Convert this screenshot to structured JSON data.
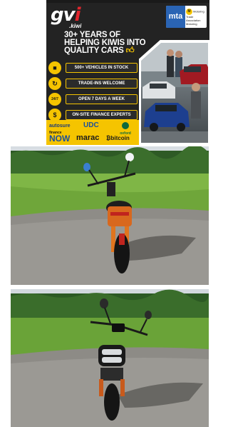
{
  "ad": {
    "logo_main_prefix": "gv",
    "logo_main_accent": "i",
    "logo_sub": ".kiwi",
    "mta_left": "mta",
    "mta_badge": "M",
    "mta_lines": [
      "Motoring",
      "Trade",
      "Association",
      "Motoring"
    ],
    "headline_line1": "30+ YEARS OF",
    "headline_line2": "HELPING KIWIS INTO",
    "headline_line3": "QUALITY CARS",
    "thumb_icon": "thumbs-up-icon",
    "features": [
      {
        "icon": "car-icon",
        "label": "500+ VEHICLES IN STOCK"
      },
      {
        "icon": "refresh-icon",
        "label": "TRADE-INS WELCOME"
      },
      {
        "icon": "clock-icon",
        "label": "OPEN 7 DAYS A WEEK"
      },
      {
        "icon": "finance-icon",
        "label": "ON-SITE FINANCE EXPERTS"
      }
    ],
    "partners": {
      "autosure": "autosure",
      "udc": "UDC",
      "oxford": "oxford",
      "now_small": "finance",
      "now": "NOW",
      "marac": "marac",
      "bitcoin": "₿bitcoin"
    },
    "colors": {
      "accent": "#f5c400",
      "brand_red": "#e3262d",
      "mta_blue": "#2a64b4",
      "bg": "#232323"
    }
  },
  "images": [
    {
      "name": "scooter-rear-view"
    },
    {
      "name": "scooter-front-view"
    }
  ]
}
